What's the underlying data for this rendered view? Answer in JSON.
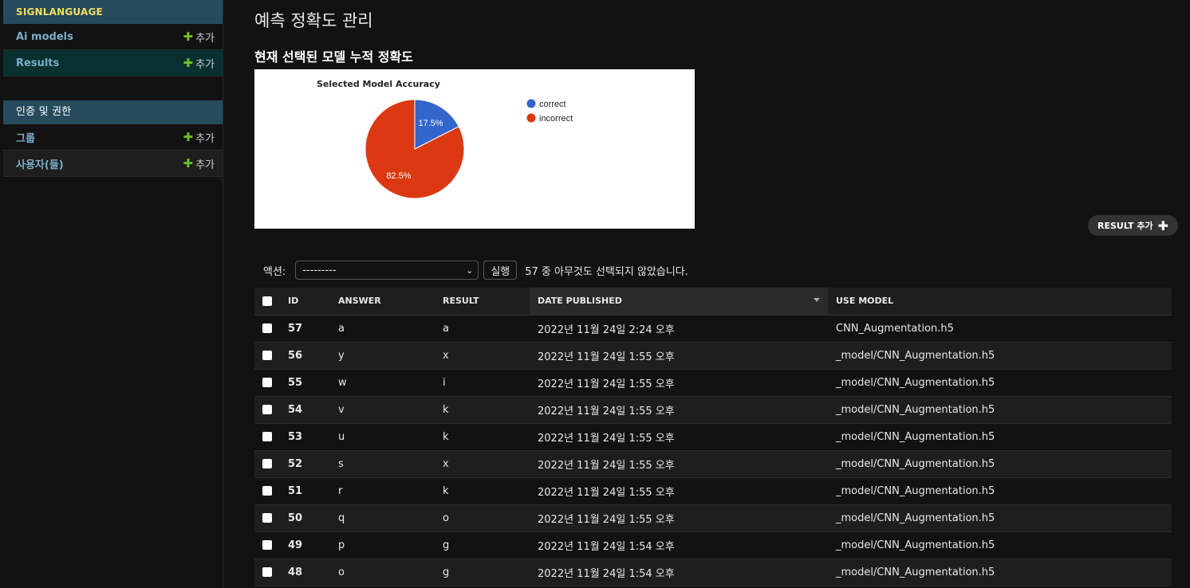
{
  "sidebar": {
    "app_section": {
      "header": "SIGNLANGUAGE",
      "items": [
        {
          "label": "Ai models",
          "add_label": "추가"
        },
        {
          "label": "Results",
          "add_label": "추가"
        }
      ]
    },
    "auth_section": {
      "header": "인증 및 권한",
      "items": [
        {
          "label": "그룹",
          "add_label": "추가"
        },
        {
          "label": "사용자(들)",
          "add_label": "추가"
        }
      ]
    }
  },
  "main": {
    "page_title": "예측 정확도 관리",
    "section_title": "현재 선택된 모델 누적 정확도",
    "add_result_label": "RESULT 추가",
    "actions": {
      "label": "액션:",
      "select_value": "---------",
      "run_label": "실행",
      "selection_counter": "57 중 아무것도 선택되지 않았습니다."
    },
    "table": {
      "columns": [
        "ID",
        "ANSWER",
        "RESULT",
        "DATE PUBLISHED",
        "USE MODEL"
      ],
      "rows": [
        {
          "id": "57",
          "answer": "a",
          "result": "a",
          "date": "2022년 11월 24일 2:24 오후",
          "model": "CNN_Augmentation.h5"
        },
        {
          "id": "56",
          "answer": "y",
          "result": "x",
          "date": "2022년 11월 24일 1:55 오후",
          "model": "_model/CNN_Augmentation.h5"
        },
        {
          "id": "55",
          "answer": "w",
          "result": "i",
          "date": "2022년 11월 24일 1:55 오후",
          "model": "_model/CNN_Augmentation.h5"
        },
        {
          "id": "54",
          "answer": "v",
          "result": "k",
          "date": "2022년 11월 24일 1:55 오후",
          "model": "_model/CNN_Augmentation.h5"
        },
        {
          "id": "53",
          "answer": "u",
          "result": "k",
          "date": "2022년 11월 24일 1:55 오후",
          "model": "_model/CNN_Augmentation.h5"
        },
        {
          "id": "52",
          "answer": "s",
          "result": "x",
          "date": "2022년 11월 24일 1:55 오후",
          "model": "_model/CNN_Augmentation.h5"
        },
        {
          "id": "51",
          "answer": "r",
          "result": "k",
          "date": "2022년 11월 24일 1:55 오후",
          "model": "_model/CNN_Augmentation.h5"
        },
        {
          "id": "50",
          "answer": "q",
          "result": "o",
          "date": "2022년 11월 24일 1:55 오후",
          "model": "_model/CNN_Augmentation.h5"
        },
        {
          "id": "49",
          "answer": "p",
          "result": "g",
          "date": "2022년 11월 24일 1:54 오후",
          "model": "_model/CNN_Augmentation.h5"
        },
        {
          "id": "48",
          "answer": "o",
          "result": "g",
          "date": "2022년 11월 24일 1:54 오후",
          "model": "_model/CNN_Augmentation.h5"
        }
      ]
    }
  },
  "chart_data": {
    "type": "pie",
    "title": "Selected Model Accuracy",
    "categories": [
      "correct",
      "incorrect"
    ],
    "values": [
      17.5,
      82.5
    ],
    "labels": [
      "17.5%",
      "82.5%"
    ],
    "colors": [
      "#3366cc",
      "#dc3912"
    ],
    "legend": "right"
  },
  "colors": {
    "accent_link": "#79aec8",
    "header_bg": "#264b5d",
    "header_text": "#f5dd5d",
    "add_plus": "#70bf2b"
  }
}
